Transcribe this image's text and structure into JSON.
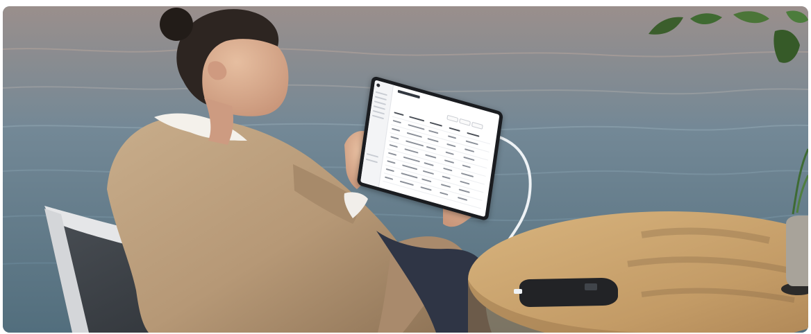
{
  "scene": {
    "subject": "woman-in-sweater",
    "background": "lake-water",
    "device": "tablet",
    "accessory": "power-bank",
    "furniture": [
      "chair",
      "round-wooden-table"
    ],
    "plant": "potted-plant"
  },
  "tablet_screen": {
    "kind": "spreadsheet-dashboard",
    "text_legible": false
  },
  "colors": {
    "water": "#6f8692",
    "sweater": "#b69876",
    "table": "#c7a16d",
    "tablet": "#1a1c20",
    "power_bank": "#222326"
  }
}
